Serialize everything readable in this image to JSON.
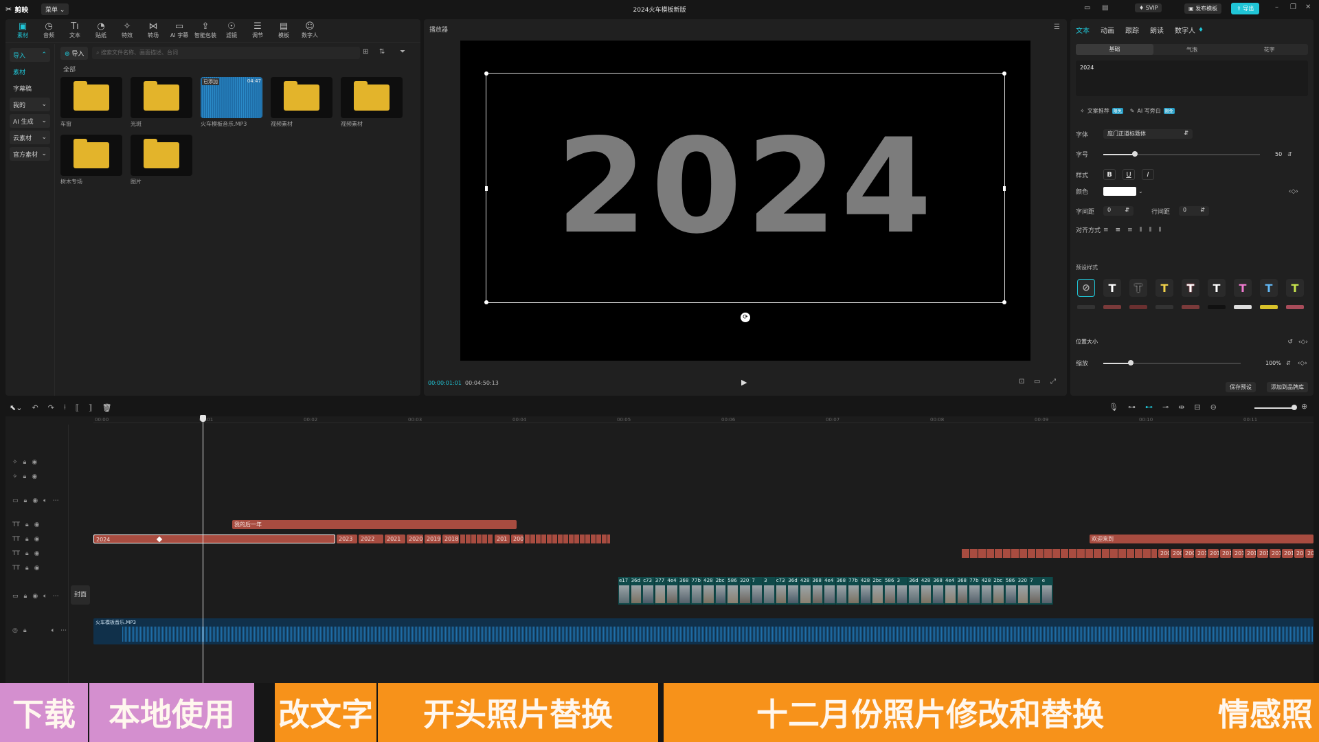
{
  "titlebar": {
    "logo": "剪映",
    "menu": "菜单",
    "title": "2024火车模板新版",
    "svip": "SVIP",
    "publish": "发布模板",
    "export": "导出"
  },
  "toolbar": {
    "items": [
      {
        "label": "素材",
        "icon": "media-icon"
      },
      {
        "label": "音频",
        "icon": "audio-icon"
      },
      {
        "label": "文本",
        "icon": "text-icon"
      },
      {
        "label": "贴纸",
        "icon": "sticker-icon"
      },
      {
        "label": "特效",
        "icon": "effects-icon"
      },
      {
        "label": "转场",
        "icon": "transition-icon"
      },
      {
        "label": "AI 字幕",
        "icon": "ai-subtitle-icon"
      },
      {
        "label": "智能包装",
        "icon": "smart-pack-icon"
      },
      {
        "label": "滤镜",
        "icon": "filter-icon"
      },
      {
        "label": "调节",
        "icon": "adjust-icon"
      },
      {
        "label": "模板",
        "icon": "template-icon"
      },
      {
        "label": "数字人",
        "icon": "digital-human-icon"
      }
    ]
  },
  "sidebar": {
    "items": [
      {
        "label": "导入"
      },
      {
        "label": "素材"
      },
      {
        "label": "字幕稿"
      },
      {
        "label": "我的"
      },
      {
        "label": "AI 生成"
      },
      {
        "label": "云素材"
      },
      {
        "label": "官方素材"
      }
    ]
  },
  "media": {
    "import_button": "导入",
    "search_placeholder": "搜索文件名称、画面描述、台词",
    "section": "全部",
    "items": [
      {
        "label": "车窗",
        "type": "folder"
      },
      {
        "label": "光斑",
        "type": "folder"
      },
      {
        "label": "火车模板音乐.MP3",
        "type": "audio",
        "badge": "已添加",
        "duration": "04:47"
      },
      {
        "label": "视频素材",
        "type": "folder"
      },
      {
        "label": "视频素材",
        "type": "folder"
      },
      {
        "label": "树木专场",
        "type": "folder"
      },
      {
        "label": "图片",
        "type": "folder"
      }
    ]
  },
  "player": {
    "title": "播放器",
    "canvas_text": "2024",
    "current_time": "00:00:01:01",
    "total_time": "00:04:50:13"
  },
  "inspector": {
    "tabs": [
      "文本",
      "动画",
      "跟踪",
      "朗读",
      "数字人"
    ],
    "subtabs": [
      "基础",
      "气泡",
      "花字"
    ],
    "text_value": "2024",
    "ai_copy": "文案推荐",
    "ai_copy_badge": "限免",
    "ai_write": "AI 写旁白",
    "ai_write_badge": "限免",
    "font_label": "字体",
    "font_value": "庞门正道标题体",
    "size_label": "字号",
    "size_value": "50",
    "size_fraction": 0.2,
    "style_label": "样式",
    "color_label": "颜色",
    "spacing_label": "字间距",
    "spacing_value": "0",
    "line_label": "行间距",
    "line_value": "0",
    "align_label": "对齐方式",
    "preset_label": "预设样式",
    "position_label": "位置大小",
    "scale_label": "缩放",
    "scale_value": "100%",
    "scale_fraction": 0.2,
    "save_preset": "保存预设",
    "add_to_library": "添加到品牌库"
  },
  "timeline": {
    "ruler": [
      "00:00",
      "00:01",
      "00:02",
      "00:03",
      "00:04",
      "00:05",
      "00:06",
      "00:07",
      "00:08",
      "00:09",
      "00:10",
      "00:11"
    ],
    "cover_label": "封面",
    "track_a_clip": "我的后一年",
    "track_b_clips": [
      "2024",
      "2023",
      "2022",
      "2021",
      "2020",
      "2019",
      "2018",
      "201",
      "200"
    ],
    "track_b_right": "欢迎来到",
    "track_c_clips": [
      "200",
      "200",
      "200",
      "201",
      "201",
      "201",
      "201",
      "201",
      "201",
      "201",
      "201",
      "201",
      "201"
    ],
    "video_thumbs": [
      "e17",
      "36d",
      "c73",
      "377",
      "4e4",
      "368",
      "77b",
      "428",
      "2bc",
      "586",
      "320",
      "7",
      "3",
      "c73",
      "36d",
      "428",
      "368",
      "4e4",
      "368",
      "77b",
      "428",
      "2bc",
      "586",
      "3",
      "36d",
      "428",
      "368",
      "4e4",
      "368",
      "77b",
      "428",
      "2bc",
      "586",
      "320",
      "7",
      "e"
    ],
    "audio_label": "火车模板音乐.MP3"
  },
  "banner": {
    "items": [
      {
        "label": "下载",
        "color": "#d48fcf"
      },
      {
        "label": "本地使用",
        "color": "#d48fcf"
      },
      {
        "label": "改文字",
        "color": "#f7921a"
      },
      {
        "label": "开头照片替换",
        "color": "#f7921a"
      },
      {
        "label": "十二月份照片修改和替换",
        "color": "#f7921a"
      },
      {
        "label": "情感照",
        "color": "#f7921a"
      }
    ]
  },
  "colors": {
    "accent": "#20c5d6",
    "clip_red": "#a84c40",
    "audio_blue": "#1f6ea8",
    "folder": "#e3b42b"
  }
}
